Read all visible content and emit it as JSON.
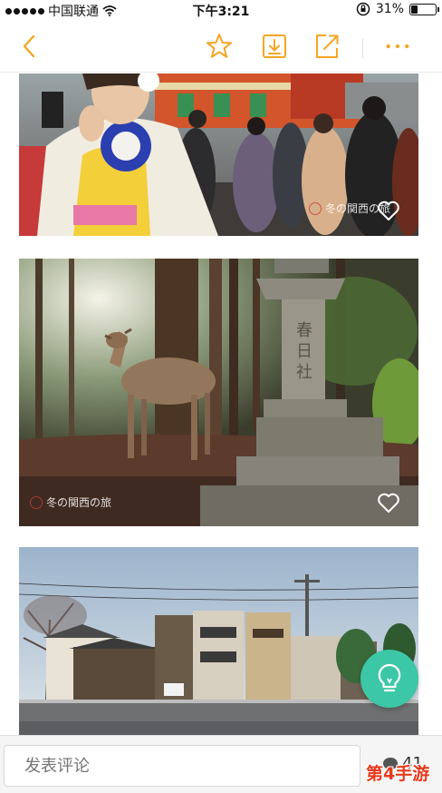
{
  "status_bar": {
    "carrier": "中国联通",
    "time": "下午3:21",
    "battery_percent": "31%",
    "battery_level": 0.31
  },
  "toolbar": {
    "icons": [
      "back-icon",
      "star-icon",
      "download-icon",
      "share-icon",
      "more-icon"
    ],
    "accent_color": "#f5a623"
  },
  "feed": {
    "photos": [
      {
        "subject": "kimono-crowd-at-shrine",
        "caption": "冬の関西の旅",
        "liked": false
      },
      {
        "subject": "deer-and-stone-lantern",
        "caption": "冬の関西の旅",
        "liked": false
      },
      {
        "subject": "kyoto-street-houses",
        "caption": "",
        "liked": false
      }
    ]
  },
  "fab": {
    "icon": "lightbulb-icon",
    "color": "#3cc7a6"
  },
  "comment_bar": {
    "placeholder": "发表评论",
    "comment_count": "41"
  },
  "watermark": "第4手游"
}
